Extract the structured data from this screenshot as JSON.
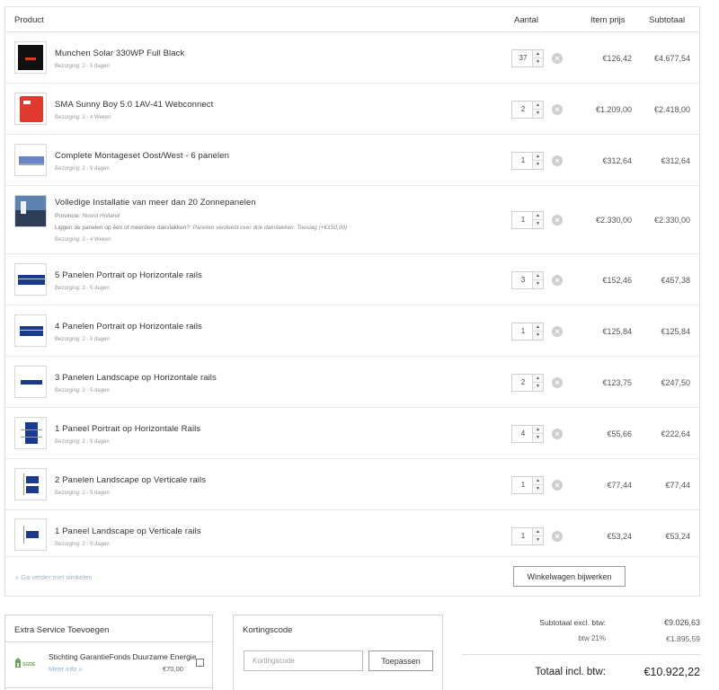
{
  "cart": {
    "headers": {
      "product": "Product",
      "quantity": "Aantal",
      "item_price": "Item prijs",
      "subtotal": "Subtotaal"
    },
    "items": [
      {
        "name": "Munchen Solar 330WP Full Black",
        "delivery": "Bezorging: 2 - 5 dagen",
        "qty": "37",
        "price": "€126,42",
        "subtotal": "€4.677,54",
        "thumb": "black-solar-panel"
      },
      {
        "name": "SMA Sunny Boy 5.0 1AV-41 Webconnect",
        "delivery": "Bezorging: 2 - 4 Weken",
        "qty": "2",
        "price": "€1.209,00",
        "subtotal": "€2.418,00",
        "thumb": "red-inverter"
      },
      {
        "name": "Complete Montageset Oost/West - 6 panelen",
        "delivery": "Bezorging: 2 - 5 dagen",
        "qty": "1",
        "price": "€312,64",
        "subtotal": "€312,64",
        "thumb": "east-west-mount"
      },
      {
        "name": "Volledige Installatie van meer dan 20 Zonnepanelen",
        "province_label": "Provincie:",
        "province": "Noord Holland",
        "roof_question": "Liggen de panelen op één of meerdere dakvlakken?:",
        "roof_answer": "Panelen verdeeld over drie dakvlakken: Toeslag (+€150,00)",
        "delivery": "Bezorging: 2 - 4 Weken",
        "qty": "1",
        "price": "€2.330,00",
        "subtotal": "€2.330,00",
        "thumb": "installer-photo"
      },
      {
        "name": "5 Panelen Portrait op Horizontale rails",
        "delivery": "Bezorging: 2 - 5 dagen",
        "qty": "3",
        "price": "€152,46",
        "subtotal": "€457,38",
        "thumb": "panels-5-portrait"
      },
      {
        "name": "4 Panelen Portrait op Horizontale rails",
        "delivery": "Bezorging: 2 - 5 dagen",
        "qty": "1",
        "price": "€125,84",
        "subtotal": "€125,84",
        "thumb": "panels-4-portrait"
      },
      {
        "name": "3 Panelen Landscape op Horizontale rails",
        "delivery": "Bezorging: 2 - 5 dagen",
        "qty": "2",
        "price": "€123,75",
        "subtotal": "€247,50",
        "thumb": "panels-3-landscape"
      },
      {
        "name": "1 Paneel Portrait op Horizontale Rails",
        "delivery": "Bezorging: 2 - 5 dagen",
        "qty": "4",
        "price": "€55,66",
        "subtotal": "€222,64",
        "thumb": "panel-1-portrait"
      },
      {
        "name": "2 Panelen Landscape op Verticale rails",
        "delivery": "Bezorging: 2 - 5 dagen",
        "qty": "1",
        "price": "€77,44",
        "subtotal": "€77,44",
        "thumb": "panels-2-landscape-vertical"
      },
      {
        "name": "1 Paneel Landscape op Verticale rails",
        "delivery": "Bezorging: 2 - 5 dagen",
        "qty": "1",
        "price": "€53,24",
        "subtotal": "€53,24",
        "thumb": "panel-1-landscape-vertical"
      }
    ],
    "continue_link": "« Ga verder met winkelen",
    "update_button": "Winkelwagen bijwerken",
    "remove_icon": "remove-circle-icon"
  },
  "extra_service": {
    "title": "Extra Service Toevoegen",
    "logo_text": "SGDE",
    "name": "Stichting GarantieFonds Duurzame Energie",
    "more_link": "Meer info »",
    "price": "€70,00"
  },
  "coupon": {
    "title": "Kortingscode",
    "placeholder": "Kortingscode",
    "apply_button": "Toepassen"
  },
  "totals": {
    "subtotal_label": "Subtotaal excl. btw:",
    "subtotal_value": "€9.026,63",
    "vat_label": "btw 21%",
    "vat_value": "€1.895,59",
    "total_label": "Totaal incl. btw:",
    "total_value": "€10.922,22"
  },
  "colors": {
    "border": "#e2e2e2",
    "link": "#8cb3d7",
    "panel_blue": "#1b3a8c",
    "inverter_red": "#e03a2f"
  }
}
